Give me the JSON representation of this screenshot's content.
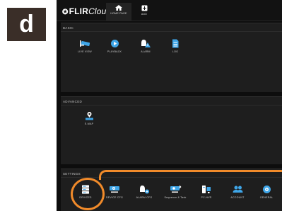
{
  "panel_label": "d",
  "app": {
    "logo_brand": "FLIR",
    "logo_suffix": "Cloud",
    "tabs": [
      {
        "label": "HOME PAGE",
        "icon": "home-icon"
      },
      {
        "label": "ADD",
        "icon": "add-icon"
      }
    ]
  },
  "sections": {
    "basic": {
      "title": "BASIC",
      "items": [
        {
          "label": "LIVE VIEW",
          "icon": "camera-icon"
        },
        {
          "label": "PLAYBACK",
          "icon": "play-icon"
        },
        {
          "label": "ALARM",
          "icon": "alarm-icon"
        },
        {
          "label": "LOG",
          "icon": "document-icon"
        }
      ]
    },
    "advanced": {
      "title": "ADVANCED",
      "items": [
        {
          "label": "E-MAP",
          "icon": "map-pin-icon"
        }
      ]
    },
    "settings": {
      "title": "SETTINGS",
      "items": [
        {
          "label": "DEVICES",
          "icon": "server-icon"
        },
        {
          "label": "DEVICE CFG",
          "icon": "device-config-icon"
        },
        {
          "label": "ALARM CFG",
          "icon": "alarm-config-icon"
        },
        {
          "label": "Sequence & Task",
          "icon": "sequence-icon"
        },
        {
          "label": "PC-NVR",
          "icon": "pc-nvr-icon"
        },
        {
          "label": "ACCOUNT",
          "icon": "users-icon"
        },
        {
          "label": "GENERAL",
          "icon": "general-settings-icon"
        }
      ]
    }
  },
  "colors": {
    "accent_blue": "#3fa6e8",
    "highlight_orange": "#f08a2a",
    "background": "#0d0d0d",
    "section_bg": "#1e1e1e"
  }
}
